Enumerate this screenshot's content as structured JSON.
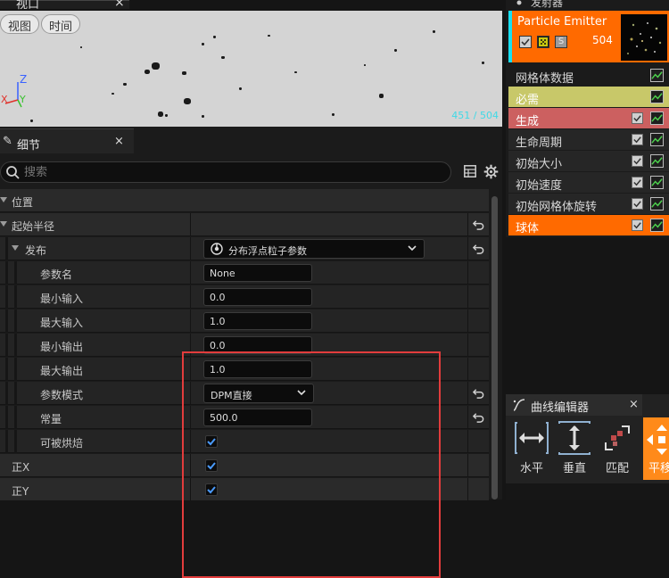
{
  "viewport": {
    "tab_title": "视口",
    "view_button": "视图",
    "time_button": "时间",
    "stat_readout": "451 / 504",
    "axis_x": "X",
    "axis_y": "Y",
    "axis_z": "Z"
  },
  "details": {
    "tab_title": "细节",
    "search_placeholder": "搜索",
    "rows": {
      "location": "位置",
      "start_radius": "起始半径",
      "distribution": "发布",
      "distribution_value": "分布浮点粒子参数",
      "param_name": "参数名",
      "param_name_value": "None",
      "min_input": "最小输入",
      "min_input_value": "0.0",
      "max_input": "最大输入",
      "max_input_value": "1.0",
      "min_output": "最小输出",
      "min_output_value": "0.0",
      "max_output": "最大输出",
      "max_output_value": "1.0",
      "param_mode": "参数模式",
      "param_mode_value": "DPM直接",
      "constant": "常量",
      "constant_value": "500.0",
      "can_bake": "可被烘焙",
      "positive_x": "正X",
      "positive_y": "正Y"
    }
  },
  "emitter": {
    "header_title": "发射器",
    "name": "Particle Emitter",
    "count": "504",
    "solo_label": "S",
    "accent_color": "#ff6a00",
    "modules": [
      {
        "label": "网格体数据",
        "bg": "#1b1b1b",
        "fg": "#d8d8d8"
      },
      {
        "label": "必需",
        "bg": "#c8c869",
        "fg": "#ffffff"
      },
      {
        "label": "生成",
        "bg": "#cc6060",
        "fg": "#ffffff"
      },
      {
        "label": "生命周期",
        "bg": "#262626",
        "fg": "#d8d8d8"
      },
      {
        "label": "初始大小",
        "bg": "#262626",
        "fg": "#d8d8d8"
      },
      {
        "label": "初始速度",
        "bg": "#262626",
        "fg": "#d8d8d8"
      },
      {
        "label": "初始网格体旋转",
        "bg": "#262626",
        "fg": "#d8d8d8"
      },
      {
        "label": "球体",
        "bg": "#ff6a00",
        "fg": "#ffffff"
      }
    ]
  },
  "curve_editor": {
    "tab_title": "曲线编辑器",
    "horizontal_label": "水平",
    "vertical_label": "垂直",
    "fit_label": "匹配",
    "pan_label": "平移"
  }
}
